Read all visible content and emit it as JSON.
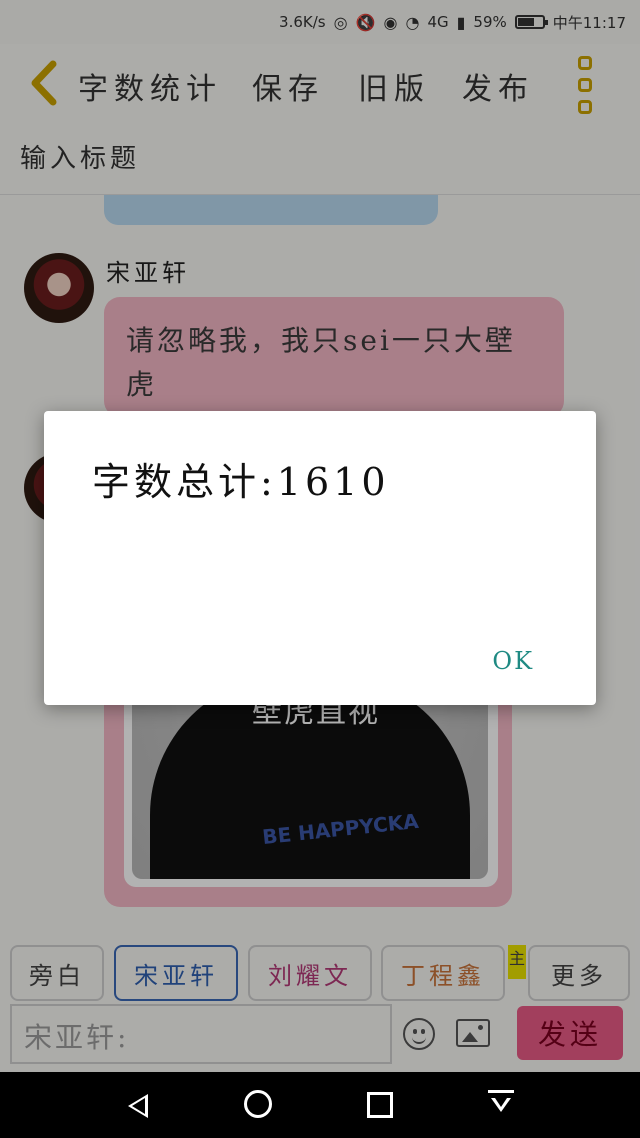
{
  "status_bar": {
    "speed": "3.6K/s",
    "network": "4G",
    "battery_percent": "59%",
    "time": "中午11:17"
  },
  "toolbar": {
    "word_count_label": "字数统计",
    "save_label": "保存",
    "old_version_label": "旧版",
    "publish_label": "发布"
  },
  "title": {
    "placeholder": "输入标题"
  },
  "chat": {
    "messages": [
      {
        "sender": "宋亚轩",
        "text": "请忽略我，我只sei一只大壁虎"
      }
    ],
    "image_caption": "壁虎直视",
    "image_brand": "BE HAPPYCKA"
  },
  "roles": [
    {
      "label": "旁白",
      "color": "#444444"
    },
    {
      "label": "宋亚轩",
      "color": "#2f5faf"
    },
    {
      "label": "刘耀文",
      "color": "#b43a77"
    },
    {
      "label": "丁程鑫",
      "color": "#c9733a"
    },
    {
      "label": "更多",
      "color": "#444444"
    }
  ],
  "role_tag": "主",
  "input": {
    "placeholder": "宋亚轩:"
  },
  "send_label": "发送",
  "dialog": {
    "message": "字数总计:1610",
    "ok_label": "OK"
  }
}
